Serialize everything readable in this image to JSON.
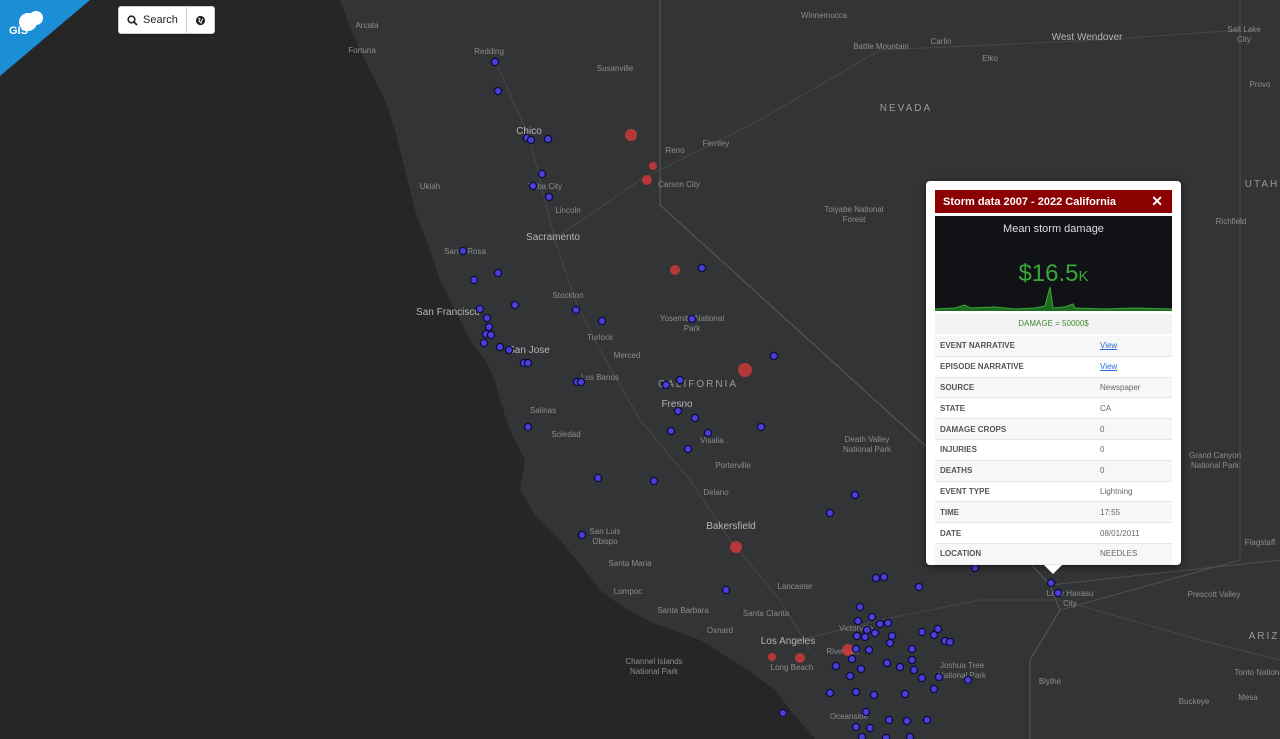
{
  "toolbar": {
    "search_label": "Search"
  },
  "logo": {
    "text": "GIS",
    "color": "#1a8fd6"
  },
  "map": {
    "state_label": "CALIFORNIA",
    "region_labels": [
      "NEVADA",
      "UTAH",
      "ARIZ"
    ],
    "cities": [
      "Arcata",
      "Fortuna",
      "Redding",
      "Susanville",
      "Winnemucca",
      "Battle Mountain",
      "Carlin",
      "Elko",
      "West Wendover",
      "Salt Lake City",
      "Provo",
      "Chico",
      "Reno",
      "Fernley",
      "Carson City",
      "Ukiah",
      "Yuba City",
      "Lincoln",
      "Sacramento",
      "Toiyabe National Forest",
      "Richfield",
      "Santa Rosa",
      "Stockton",
      "San Francisco",
      "Turlock",
      "Yosemite National Park",
      "San Jose",
      "Merced",
      "Los Banos",
      "Salinas",
      "Fresno",
      "Soledad",
      "Visalia",
      "Porterville",
      "Death Valley National Park",
      "Grand Canyon National Park",
      "Delano",
      "Bakersfield",
      "San Luis Obispo",
      "Santa Maria",
      "Lompoc",
      "Lancaster",
      "Flagstaff",
      "Santa Barbara",
      "Santa Clarita",
      "Victorville",
      "Lake Havasu City",
      "Prescott Valley",
      "Oxnard",
      "Los Angeles",
      "Riverside",
      "Long Beach",
      "Joshua Tree National Park",
      "Channel Islands National Park",
      "Tonto National",
      "Blythe",
      "Oceanside",
      "Buckeye",
      "Mesa"
    ],
    "marker_colors": {
      "point": "#4a3fd9",
      "storm": "#e03a3a"
    }
  },
  "popup": {
    "title": "Storm data 2007 - 2022 California",
    "close": "✕",
    "chart_title": "Mean storm damage",
    "chart_value": "$16.5",
    "chart_unit": "K",
    "damage_line": "DAMAGE = 50000$",
    "rows": [
      {
        "key": "EVENT NARRATIVE",
        "value": "View"
      },
      {
        "key": "EPISODE NARRATIVE",
        "value": "View"
      },
      {
        "key": "SOURCE",
        "value": "Newspaper"
      },
      {
        "key": "STATE",
        "value": "CA"
      },
      {
        "key": "DAMAGE CROPS",
        "value": "0"
      },
      {
        "key": "INJURIES",
        "value": "0"
      },
      {
        "key": "DEATHS",
        "value": "0"
      },
      {
        "key": "EVENT TYPE",
        "value": "Lightning"
      },
      {
        "key": "TIME",
        "value": "17:55"
      },
      {
        "key": "DATE",
        "value": "08/01/2011"
      },
      {
        "key": "LOCATION",
        "value": "NEEDLES"
      }
    ]
  }
}
